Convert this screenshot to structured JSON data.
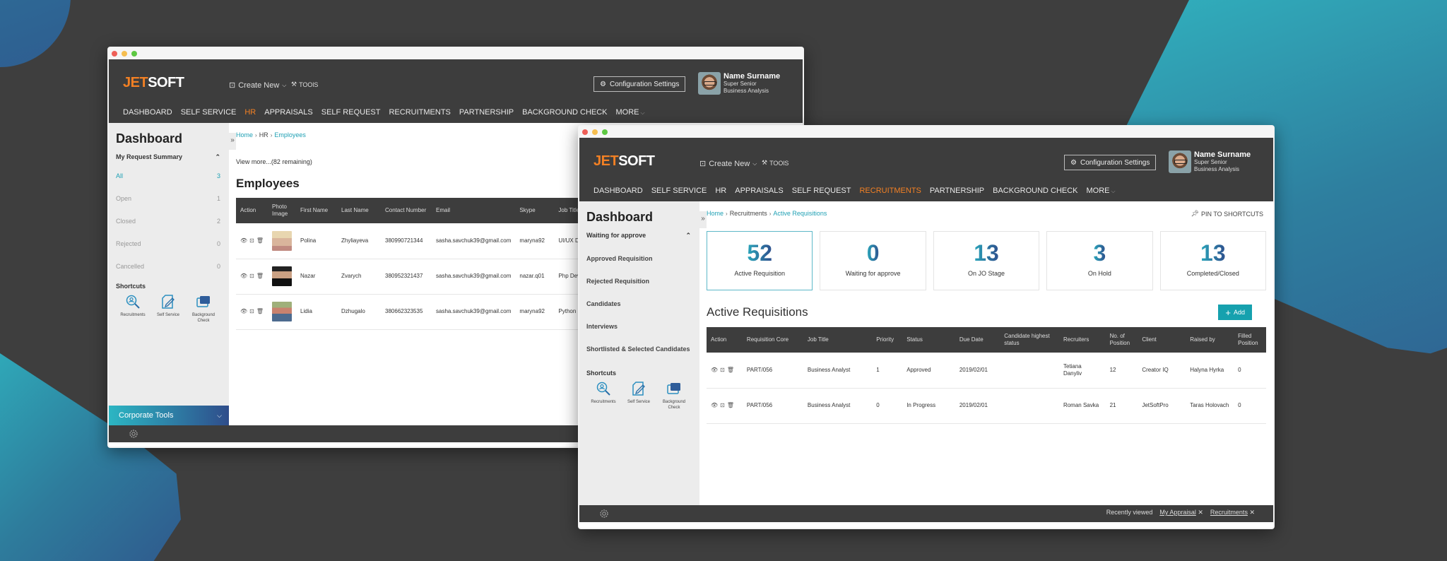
{
  "brand": {
    "jet": "JET",
    "soft": "SOFT"
  },
  "header": {
    "create_new": "Create New",
    "tools": "TOOlS",
    "config_settings": "Configuration Settings",
    "user": {
      "name": "Name Surname",
      "title": "Super Senior",
      "role": "Business Analysis"
    }
  },
  "nav": [
    "DASHBOARD",
    "SELF SERVICE",
    "HR",
    "APPRAISALS",
    "SELF REQUEST",
    "RECRUITMENTS",
    "PARTNERSHIP",
    "BACKGROUND CHECK",
    "MORE"
  ],
  "colors": {
    "accent": "#f28024",
    "link": "#1fa0b4",
    "header_bg": "#3d3d3d",
    "add_button": "#16a1ae"
  },
  "shortcuts": {
    "title": "Shortcuts",
    "items": [
      {
        "label": "Recruitments",
        "icon": "search-user-icon"
      },
      {
        "label": "Self Service",
        "icon": "edit-document-icon"
      },
      {
        "label": "Background Check",
        "icon": "windows-stack-icon"
      }
    ]
  },
  "window1": {
    "active_nav": "HR",
    "sidebar": {
      "title": "Dashboard",
      "section": "My Request Summary",
      "items": [
        {
          "label": "All",
          "count": "3"
        },
        {
          "label": "Open",
          "count": "1"
        },
        {
          "label": "Closed",
          "count": "2"
        },
        {
          "label": "Rejected",
          "count": "0"
        },
        {
          "label": "Cancelled",
          "count": "0"
        }
      ],
      "corporate_tools": "Corporate Tools"
    },
    "breadcrumb": [
      "Home",
      "HR",
      "Employees"
    ],
    "view_more": "View more...(82 remaining)",
    "page_title": "Employees",
    "table": {
      "columns": [
        "Action",
        "Photo Image",
        "First Name",
        "Last Name",
        "Contact Number",
        "Email",
        "Skype",
        "Job Title"
      ],
      "rows": [
        {
          "first": "Polina",
          "last": "Zhyliayeva",
          "phone": "380990721344",
          "email": "sasha.savchuk39@gmail.com",
          "skype": "maryna92",
          "job": "UI/UX Designer"
        },
        {
          "first": "Nazar",
          "last": "Zvarych",
          "phone": "380952321437",
          "email": "sasha.savchuk39@gmail.com",
          "skype": "nazar.q01",
          "job": "Php Developer"
        },
        {
          "first": "Lidia",
          "last": "Dzhugalo",
          "phone": "380662323535",
          "email": "sasha.savchuk39@gmail.com",
          "skype": "maryna92",
          "job": "Python Developer"
        }
      ]
    }
  },
  "window2": {
    "active_nav": "RECRUITMENTS",
    "sidebar": {
      "title": "Dashboard",
      "section": "Waiting  for approve",
      "links": [
        "Approved Requisition",
        "Rejected Requisition",
        "Candidates",
        "Interviews",
        "Shortlisted & Selected Candidates"
      ]
    },
    "breadcrumb": [
      "Home",
      "Recruitments",
      "Active Requisitions"
    ],
    "pin": "PIN TO SHORTCUTS",
    "stats": [
      {
        "value": "52",
        "label": "Active Requisition"
      },
      {
        "value": "0",
        "label": "Waiting for approve"
      },
      {
        "value": "13",
        "label": "On JO Stage"
      },
      {
        "value": "3",
        "label": "On Hold"
      },
      {
        "value": "13",
        "label": "Completed/Closed"
      }
    ],
    "section_title": "Active Requisitions",
    "add_label": "Add",
    "table": {
      "columns": [
        "Action",
        "Requisition Core",
        "Job Title",
        "Priority",
        "Status",
        "Due Date",
        "Candidate highest status",
        "Recruiters",
        "No. of Position",
        "Client",
        "Raised by",
        "Filled Position"
      ],
      "rows": [
        {
          "code": "PART/056",
          "job": "Business Analyst",
          "priority": "1",
          "status": "Approved",
          "due": "2019/02/01",
          "cand": "",
          "recruiter": "Tetiana Danyliv",
          "positions": "12",
          "client": "Creator IQ",
          "raised": "Halyna Hyrka",
          "filled": "0"
        },
        {
          "code": "PART/056",
          "job": "Business Analyst",
          "priority": "0",
          "status": "In Progress",
          "due": "2019/02/01",
          "cand": "",
          "recruiter": "Roman Savka",
          "positions": "21",
          "client": "JetSoftPro",
          "raised": "Taras Holovach",
          "filled": "0"
        }
      ]
    },
    "footer": {
      "recently_viewed": "Recently viewed",
      "tags": [
        "My Appraisal",
        "Recruitments"
      ]
    }
  }
}
